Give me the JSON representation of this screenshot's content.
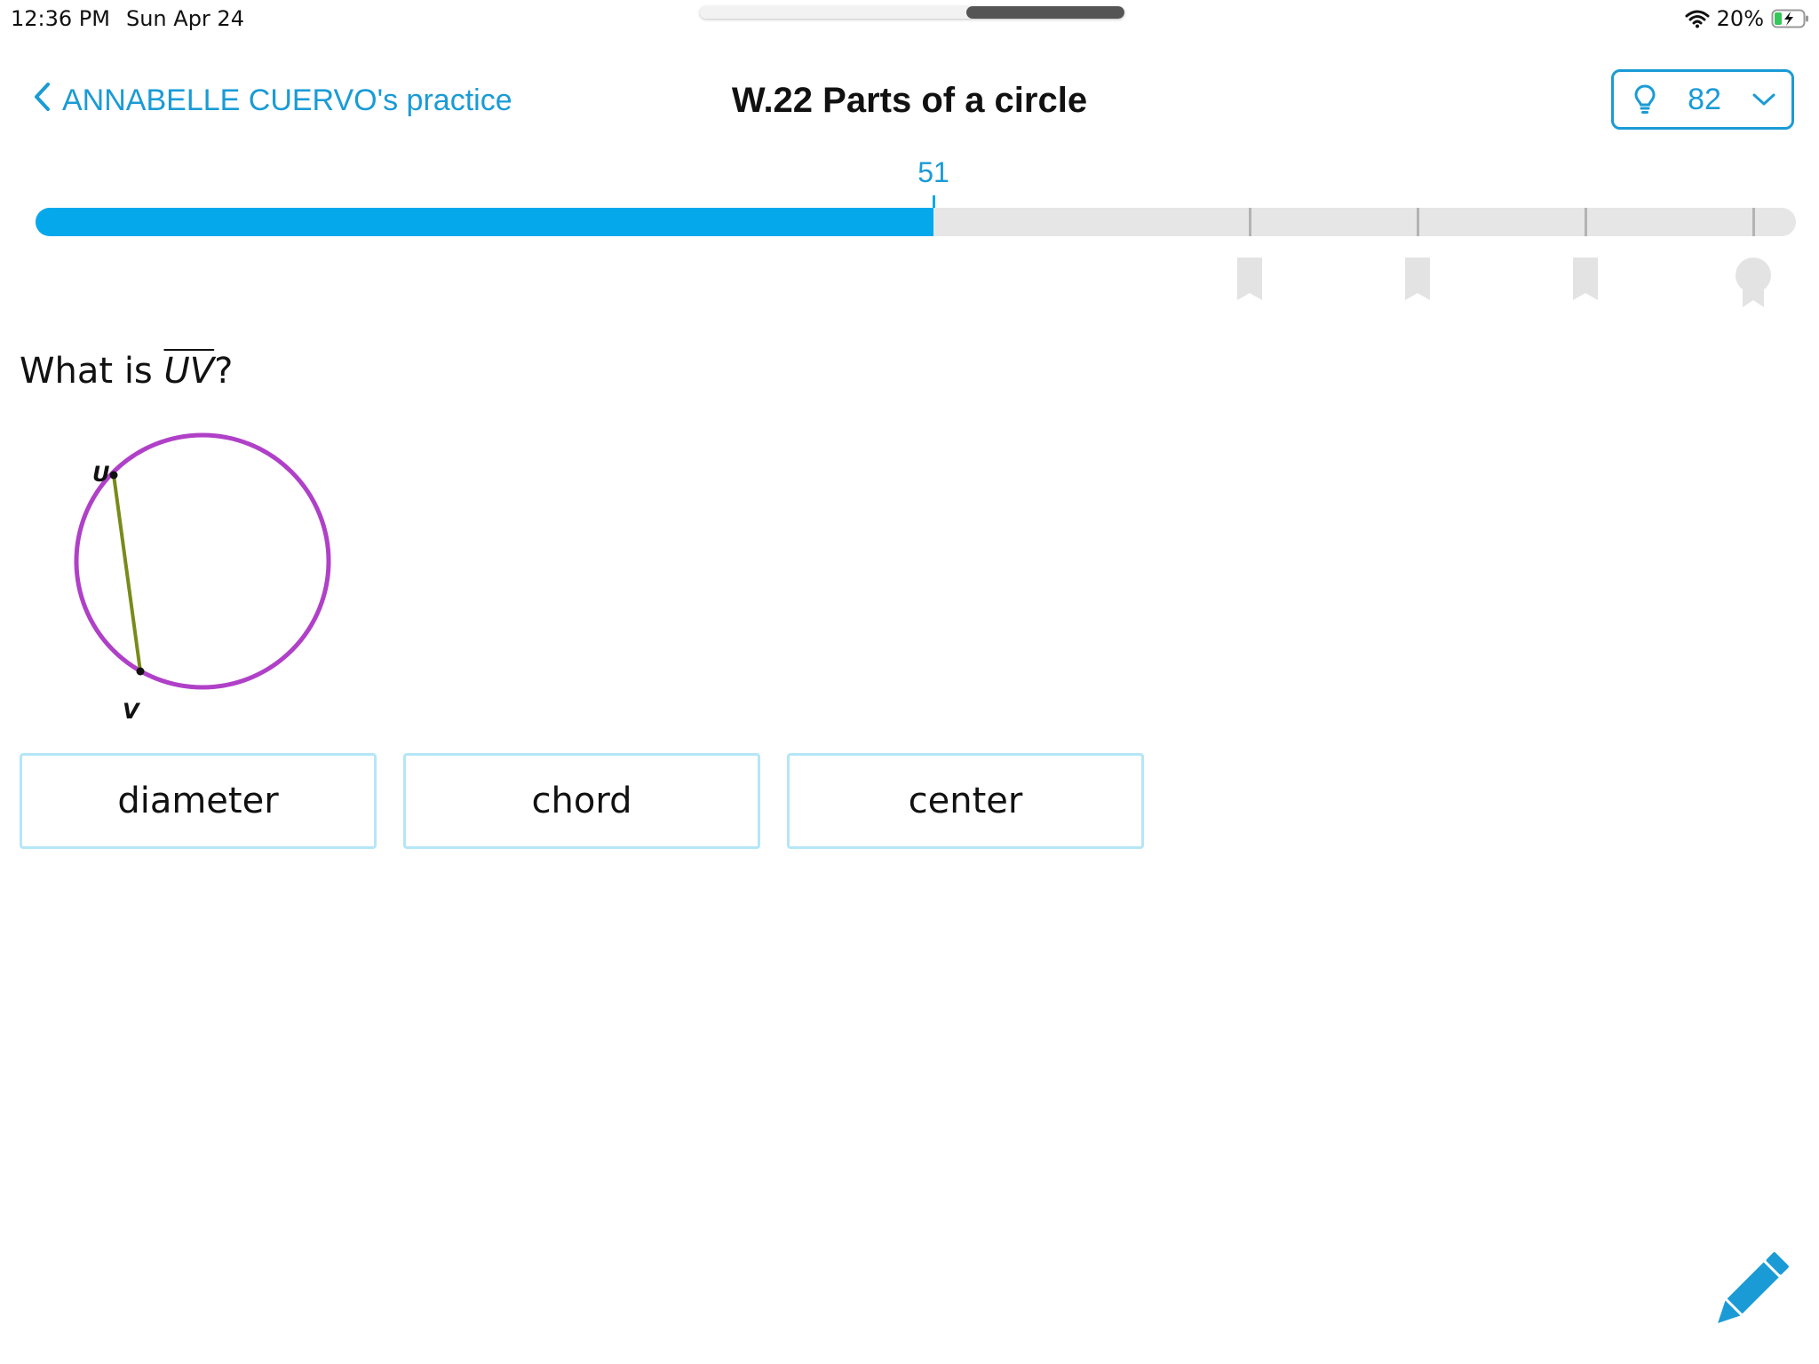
{
  "status_bar": {
    "time": "12:36 PM",
    "date": "Sun Apr 24",
    "battery": "20%",
    "icons": [
      "wifi-icon",
      "battery-charging-icon"
    ]
  },
  "header": {
    "back_label": "ANNABELLE CUERVO's practice",
    "title": "W.22 Parts of a circle",
    "score": "82",
    "icons": [
      "chevron-left-icon",
      "lightbulb-icon",
      "chevron-down-icon"
    ]
  },
  "progress": {
    "value": 51,
    "label": "51",
    "max": 100,
    "milestones": [
      "bookmark-icon",
      "bookmark-icon",
      "bookmark-icon",
      "award-icon"
    ]
  },
  "colors": {
    "accent": "#1a9bd6",
    "progress_fill": "#06a8ec",
    "circle": "#b040c8",
    "chord": "#7a8a1a"
  },
  "question": {
    "prefix": "What is ",
    "segment": "UV",
    "suffix": "?"
  },
  "diagram": {
    "point_u": "U",
    "point_v": "V"
  },
  "answers": [
    "diameter",
    "chord",
    "center"
  ],
  "tools": {
    "pencil_icon": "pencil-icon"
  }
}
